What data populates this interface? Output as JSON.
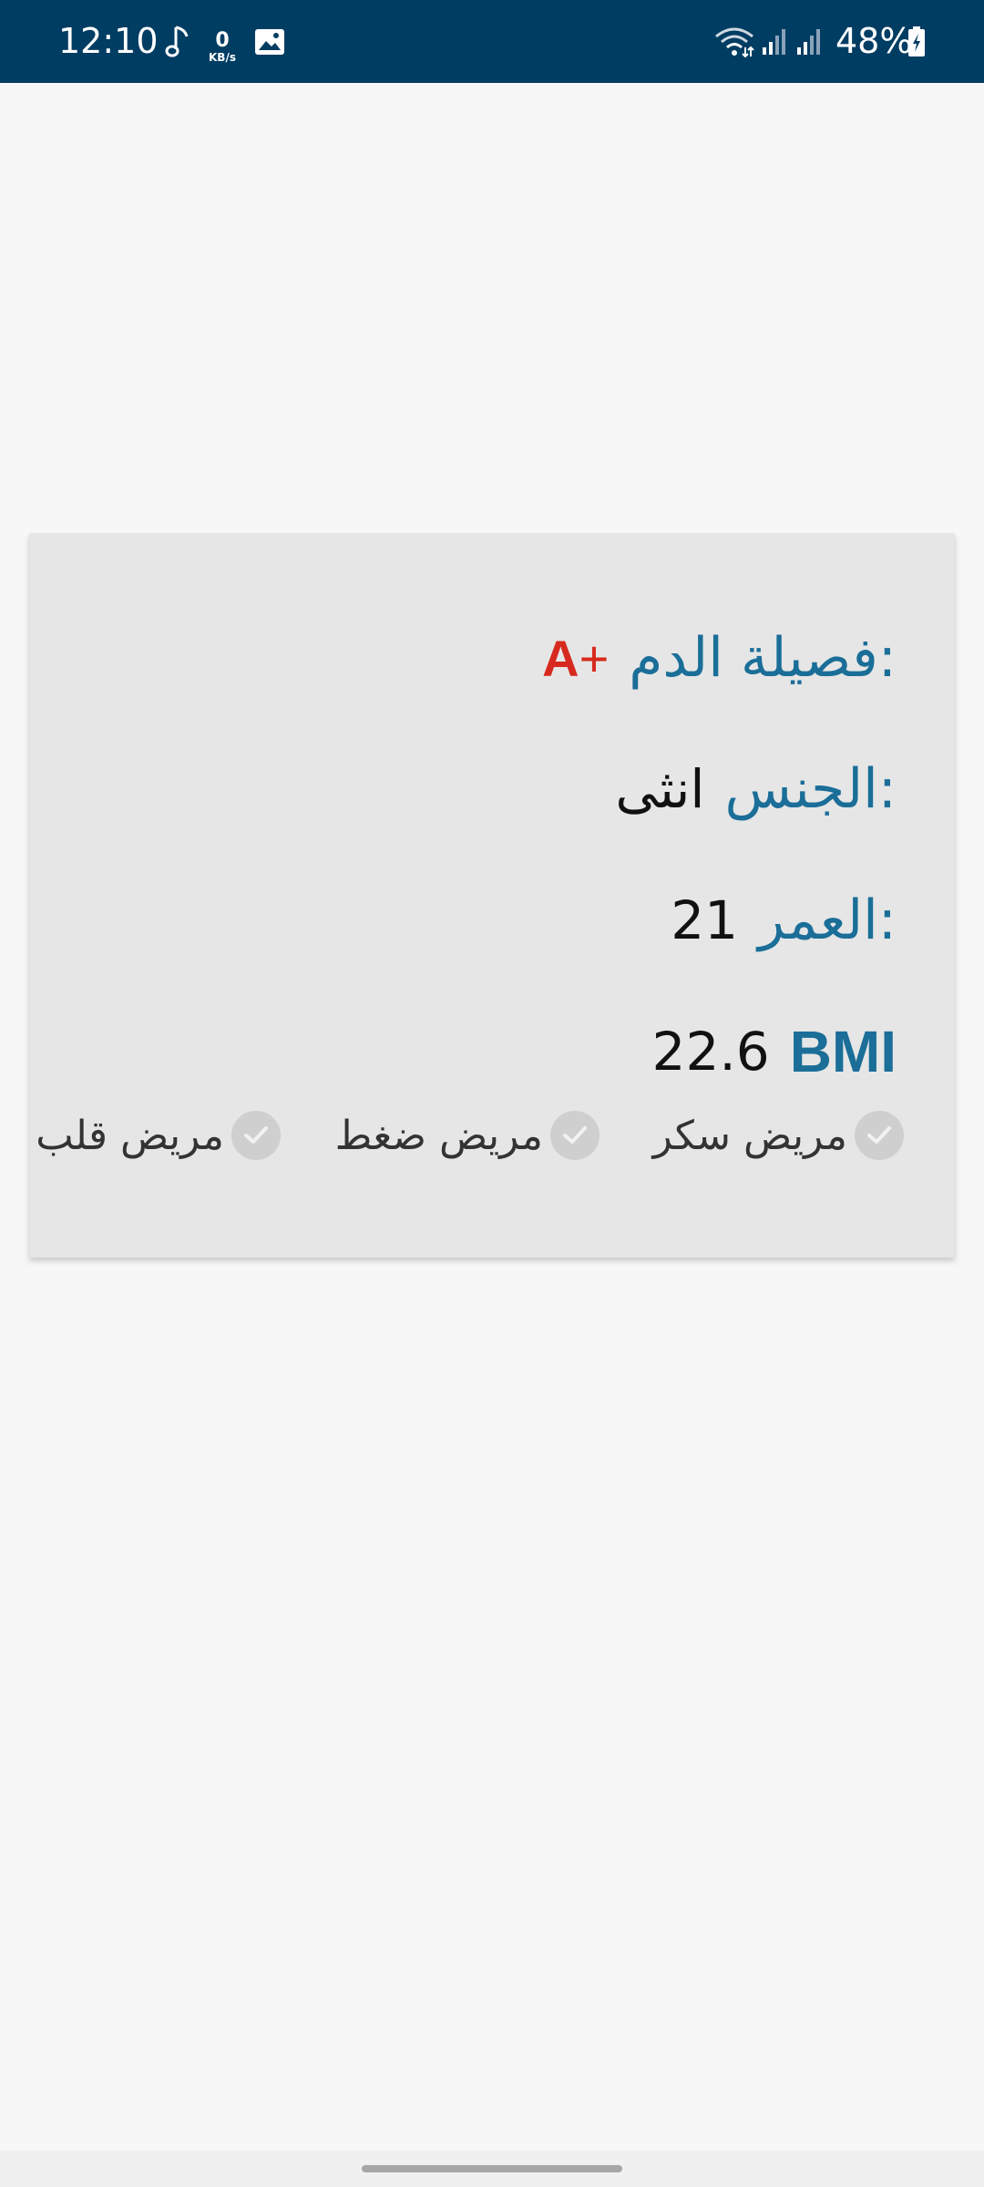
{
  "status_bar": {
    "time": "12:10",
    "kbs_value": "0",
    "kbs_unit": "KB/s",
    "battery": "48%",
    "icons": [
      "music-note-icon",
      "network-speed-icon",
      "image-icon",
      "wifi-icon",
      "signal-icon",
      "signal-icon",
      "battery-charging-icon"
    ]
  },
  "profile": {
    "blood_type_label": "فصيلة الدم:",
    "blood_type_letter": "A",
    "blood_type_sign": "+",
    "gender_label": "الجنس:",
    "gender_value": "انثى",
    "age_label": "العمر:",
    "age_value": "21",
    "bmi_label": "BMI",
    "bmi_value": "22.6"
  },
  "conditions": [
    {
      "label": "مريض سكر",
      "checked": false
    },
    {
      "label": "مريض ضغط",
      "checked": false
    },
    {
      "label": "مريض قلب",
      "checked": false
    }
  ],
  "colors": {
    "status_bar_bg": "#003d63",
    "label_blue": "#1a6e98",
    "blood_red": "#d62a1e",
    "card_bg": "#e6e6e6",
    "check_grey": "#cfcfcf"
  }
}
